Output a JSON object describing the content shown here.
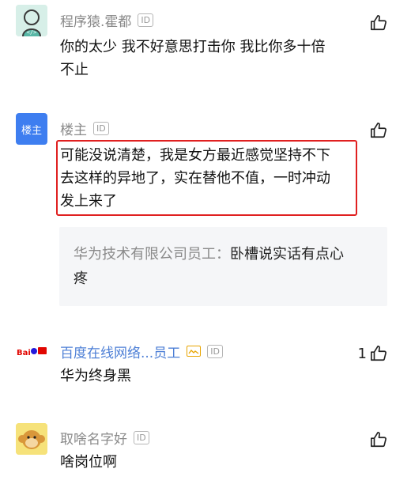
{
  "comments": [
    {
      "user": "程序猿.霍都",
      "badge": "ID",
      "text": "你的太少 我不好意思打击你  我比你多十倍不止",
      "text_line1": "你的太少 我不好意思打击你  我比你多十倍",
      "text_line2": "不止"
    },
    {
      "user": "楼主",
      "avatar_label": "楼主",
      "badge": "ID",
      "text_line1": "可能没说清楚，我是女方最近感觉坚持不下",
      "text_line2": "去这样的异地了，实在替他不值，一时冲动",
      "text_line3": "发上来了",
      "quote": {
        "name": "华为技术有限公司员工：",
        "text_line1": "卧槽说实话有点心",
        "text_line2": "疼"
      }
    },
    {
      "user": "百度在线网络...员工",
      "badge": "ID",
      "likes": "1",
      "text": "华为终身黑"
    },
    {
      "user": "取啥名字好",
      "badge": "ID",
      "text": "啥岗位啊"
    }
  ],
  "colors": {
    "name_gray": "#8a8a8a",
    "name_blue": "#4d7fd6",
    "highlight_red": "#e02020",
    "lz_avatar": "#3e7ef0",
    "quote_bg": "#f5f6f8"
  }
}
